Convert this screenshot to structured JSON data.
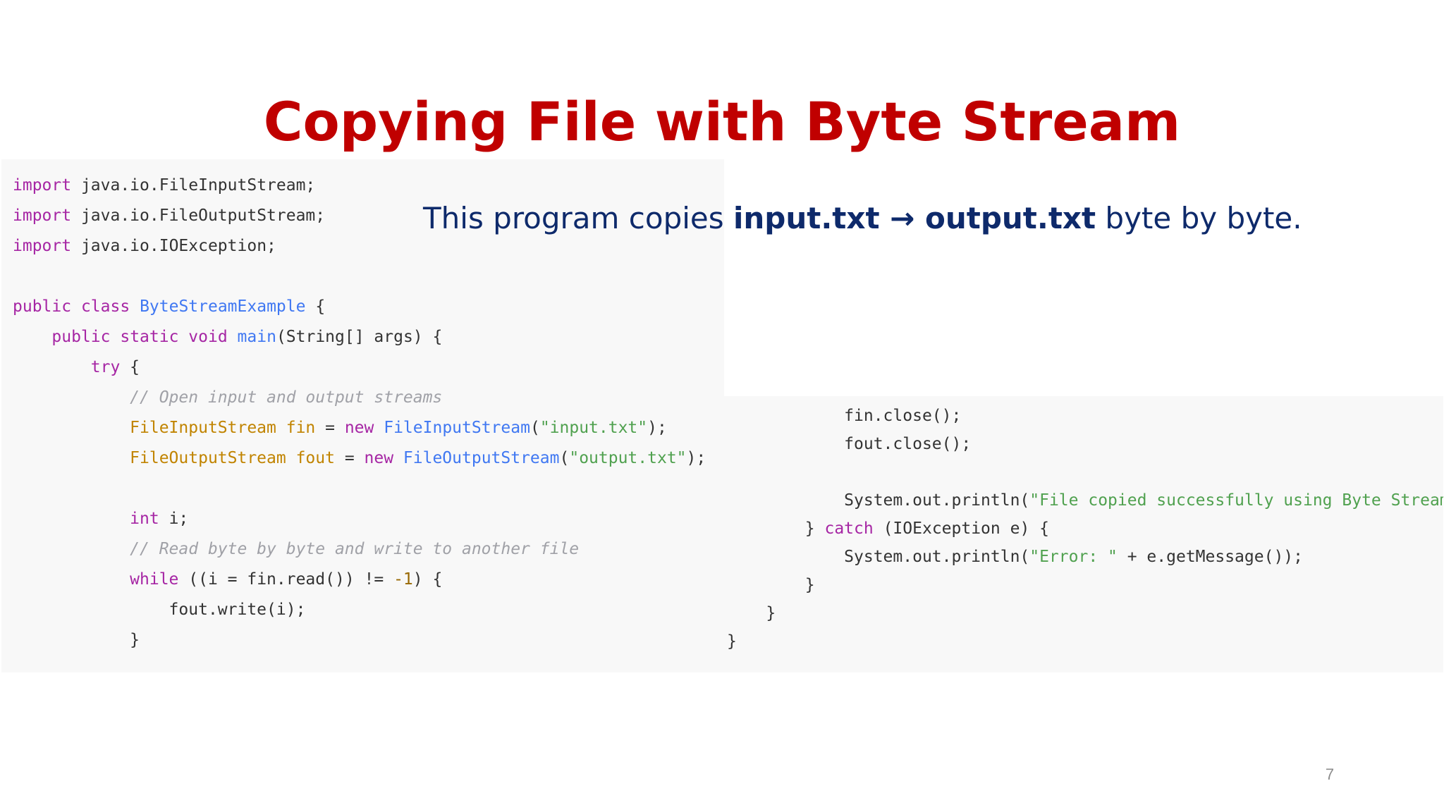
{
  "slide": {
    "title": "Copying File with Byte Stream",
    "subtitle": {
      "prefix": "This program copies ",
      "input_file": "input.txt",
      "arrow": " → ",
      "output_file": "output.txt",
      "suffix": " byte by byte."
    },
    "page_number": "7"
  },
  "code_left": [
    [
      [
        "kw",
        "import"
      ],
      [
        "plain",
        " java.io.FileInputStream;"
      ]
    ],
    [
      [
        "kw",
        "import"
      ],
      [
        "plain",
        " java.io.FileOutputStream;"
      ]
    ],
    [
      [
        "kw",
        "import"
      ],
      [
        "plain",
        " java.io.IOException;"
      ]
    ],
    [],
    [
      [
        "kw",
        "public"
      ],
      [
        "plain",
        " "
      ],
      [
        "kw",
        "class"
      ],
      [
        "plain",
        " "
      ],
      [
        "fn",
        "ByteStreamExample"
      ],
      [
        "plain",
        " {"
      ]
    ],
    [
      [
        "plain",
        "    "
      ],
      [
        "kw",
        "public"
      ],
      [
        "plain",
        " "
      ],
      [
        "kw",
        "static"
      ],
      [
        "plain",
        " "
      ],
      [
        "kw",
        "void"
      ],
      [
        "plain",
        " "
      ],
      [
        "fn",
        "main"
      ],
      [
        "plain",
        "(String[] args) {"
      ]
    ],
    [
      [
        "plain",
        "        "
      ],
      [
        "kw",
        "try"
      ],
      [
        "plain",
        " {"
      ]
    ],
    [
      [
        "plain",
        "            "
      ],
      [
        "com",
        "// Open input and output streams"
      ]
    ],
    [
      [
        "plain",
        "            "
      ],
      [
        "cls",
        "FileInputStream fin"
      ],
      [
        "plain",
        " = "
      ],
      [
        "kw",
        "new"
      ],
      [
        "plain",
        " "
      ],
      [
        "fn",
        "FileInputStream"
      ],
      [
        "plain",
        "("
      ],
      [
        "str",
        "\"input.txt\""
      ],
      [
        "plain",
        ");"
      ]
    ],
    [
      [
        "plain",
        "            "
      ],
      [
        "cls",
        "FileOutputStream fout"
      ],
      [
        "plain",
        " = "
      ],
      [
        "kw",
        "new"
      ],
      [
        "plain",
        " "
      ],
      [
        "fn",
        "FileOutputStream"
      ],
      [
        "plain",
        "("
      ],
      [
        "str",
        "\"output.txt\""
      ],
      [
        "plain",
        ");"
      ]
    ],
    [],
    [
      [
        "plain",
        "            "
      ],
      [
        "kw",
        "int"
      ],
      [
        "plain",
        " i;"
      ]
    ],
    [
      [
        "plain",
        "            "
      ],
      [
        "com",
        "// Read byte by byte and write to another file"
      ]
    ],
    [
      [
        "plain",
        "            "
      ],
      [
        "kw",
        "while"
      ],
      [
        "plain",
        " ((i = fin.read()) != "
      ],
      [
        "num",
        "-1"
      ],
      [
        "plain",
        ") {"
      ]
    ],
    [
      [
        "plain",
        "                fout.write(i);"
      ]
    ],
    [
      [
        "plain",
        "            }"
      ]
    ]
  ],
  "code_right": [
    [
      [
        "plain",
        "            fin.close();"
      ]
    ],
    [
      [
        "plain",
        "            fout.close();"
      ]
    ],
    [],
    [
      [
        "plain",
        "            System.out.println("
      ],
      [
        "str",
        "\"File copied successfully using Byte Stream!\""
      ],
      [
        "plain",
        ");"
      ]
    ],
    [
      [
        "plain",
        "        } "
      ],
      [
        "kw",
        "catch"
      ],
      [
        "plain",
        " (IOException e) {"
      ]
    ],
    [
      [
        "plain",
        "            System.out.println("
      ],
      [
        "str",
        "\"Error: \""
      ],
      [
        "plain",
        " + e.getMessage());"
      ]
    ],
    [
      [
        "plain",
        "        }"
      ]
    ],
    [
      [
        "plain",
        "    }"
      ]
    ],
    [
      [
        "plain",
        "}"
      ]
    ]
  ]
}
